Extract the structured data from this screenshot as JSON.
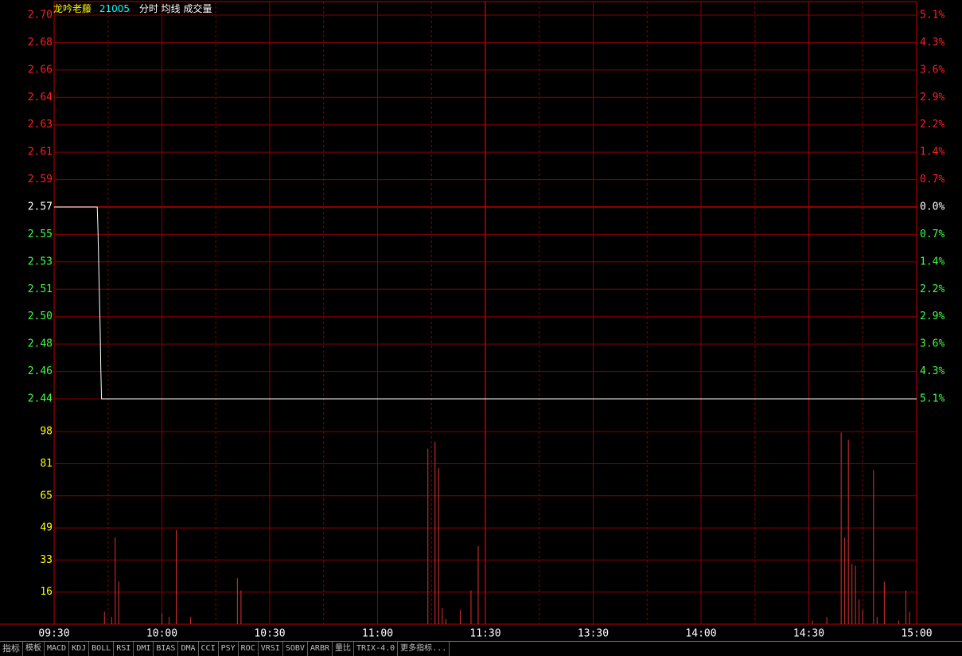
{
  "header": {
    "name": "龙吟老藤",
    "code": "21005",
    "label": "分时 均线 成交量",
    "colors": {
      "name": "#ffff00",
      "code": "#00ffff",
      "label": "#ffffff"
    }
  },
  "chart_data": {
    "type": "line",
    "price_axis": {
      "ticks": [
        "2.70",
        "2.68",
        "2.66",
        "2.64",
        "2.63",
        "2.61",
        "2.59",
        "2.57",
        "2.55",
        "2.53",
        "2.51",
        "2.50",
        "2.48",
        "2.46",
        "2.44"
      ],
      "base": "2.57",
      "ylim": [
        2.44,
        2.7
      ]
    },
    "pct_axis": {
      "ticks": [
        "5.1%",
        "4.3%",
        "3.6%",
        "2.9%",
        "2.2%",
        "1.4%",
        "0.7%",
        "0.0%",
        "0.7%",
        "1.4%",
        "2.2%",
        "2.9%",
        "3.6%",
        "4.3%",
        "5.1%"
      ]
    },
    "volume_axis": {
      "ticks": [
        "98",
        "81",
        "65",
        "49",
        "33",
        "16"
      ],
      "ylim": [
        0,
        114
      ]
    },
    "time_axis": {
      "labels": [
        "09:30",
        "10:00",
        "10:30",
        "11:00",
        "11:30",
        "13:30",
        "14:00",
        "14:30",
        "15:00"
      ],
      "minutes": 240
    },
    "price_series": [
      [
        0,
        2.57
      ],
      [
        12,
        2.57
      ],
      [
        12.2,
        2.555
      ],
      [
        12.5,
        2.52
      ],
      [
        12.8,
        2.49
      ],
      [
        13,
        2.46
      ],
      [
        13.2,
        2.44
      ],
      [
        240,
        2.44
      ]
    ],
    "volume_series": [
      [
        14,
        7
      ],
      [
        16,
        4
      ],
      [
        17,
        49
      ],
      [
        18,
        24
      ],
      [
        30,
        6
      ],
      [
        32,
        4
      ],
      [
        34,
        53
      ],
      [
        38,
        4
      ],
      [
        51,
        26
      ],
      [
        52,
        19
      ],
      [
        104,
        99
      ],
      [
        106,
        103
      ],
      [
        107,
        88
      ],
      [
        108,
        9
      ],
      [
        109,
        3
      ],
      [
        113,
        8
      ],
      [
        116,
        19
      ],
      [
        118,
        44
      ],
      [
        211,
        2
      ],
      [
        215,
        4
      ],
      [
        219,
        108
      ],
      [
        220,
        49
      ],
      [
        221,
        104
      ],
      [
        222,
        34
      ],
      [
        223,
        33
      ],
      [
        224,
        14
      ],
      [
        225,
        8
      ],
      [
        228,
        87
      ],
      [
        229,
        4
      ],
      [
        231,
        24
      ],
      [
        235,
        2
      ],
      [
        237,
        19
      ],
      [
        238,
        7
      ]
    ],
    "colors": {
      "grid": "#8b0000",
      "axis": "#c00000",
      "up": "#ff2020",
      "down": "#40ff40",
      "flat": "#ffffff",
      "volume": "#e03030",
      "price_line": "#ffffff",
      "time_label": "#ffffff",
      "volume_label": "#ffff00"
    }
  },
  "indicator_tabs": [
    "指标",
    "模板",
    "MACD",
    "KDJ",
    "BOLL",
    "RSI",
    "DMI",
    "BIAS",
    "DMA",
    "CCI",
    "PSY",
    "ROC",
    "VRSI",
    "SOBV",
    "ARBR",
    "量比",
    "TRIX-4.0",
    "更多指标..."
  ]
}
